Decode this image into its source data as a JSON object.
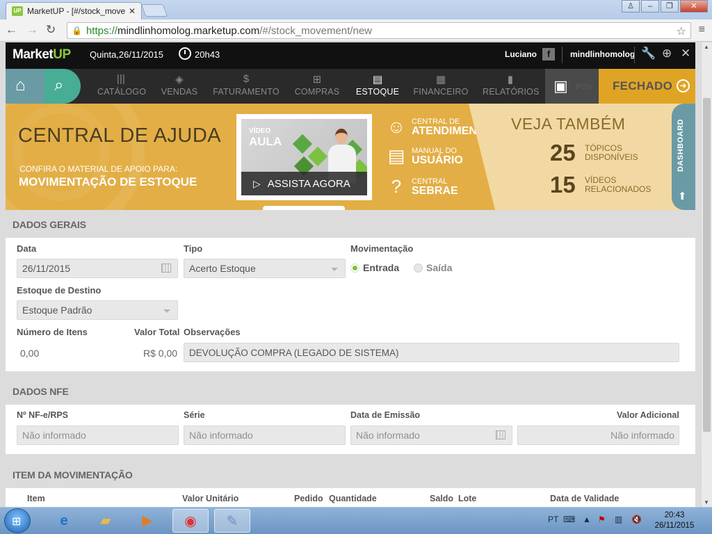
{
  "browser": {
    "tab_title": "MarketUP - [#/stock_move",
    "tab_favicon": "UP",
    "url_scheme": "https://",
    "url_host": "mindlinhomolog.marketup.com",
    "url_path": "/#/stock_movement/new"
  },
  "appbar": {
    "logo_market": "Market",
    "logo_up": "UP",
    "date": "Quinta,26/11/2015",
    "time": "20h43",
    "user": "Luciano",
    "account": "mindlinhomolog"
  },
  "nav": {
    "items": [
      {
        "label": "CATÁLOGO",
        "icon": "|||"
      },
      {
        "label": "VENDAS",
        "icon": "◈"
      },
      {
        "label": "FATURAMENTO",
        "icon": "$"
      },
      {
        "label": "COMPRAS",
        "icon": "⊞"
      },
      {
        "label": "ESTOQUE",
        "icon": "▤"
      },
      {
        "label": "FINANCEIRO",
        "icon": "▦"
      },
      {
        "label": "RELATÓRIOS",
        "icon": "▮"
      }
    ],
    "pdv": "PDV",
    "status": "FECHADO"
  },
  "banner": {
    "title": "CENTRAL DE AJUDA",
    "subtitle": "CONFIRA O MATERIAL DE APOIO PARA:",
    "topic": "MOVIMENTAÇÃO DE ESTOQUE",
    "video_tag1": "VÍDEO",
    "video_tag2": "AULA",
    "video_cta": "ASSISTA AGORA",
    "links": [
      {
        "line1": "CENTRAL DE",
        "line2": "ATENDIMENTO"
      },
      {
        "line1": "MANUAL DO",
        "line2": "USUÁRIO"
      },
      {
        "line1": "CENTRAL",
        "line2": "SEBRAE"
      }
    ],
    "see_also": "VEJA TAMBÉM",
    "topics_count": "25",
    "topics_label1": "TÓPICOS",
    "topics_label2": "DISPONÍVEIS",
    "videos_count": "15",
    "videos_label1": "VÍDEOS",
    "videos_label2": "RELACIONADOS",
    "dashboard": "DASHBOARD"
  },
  "dados_gerais": {
    "title": "DADOS GERAIS",
    "data_label": "Data",
    "data_value": "26/11/2015",
    "tipo_label": "Tipo",
    "tipo_value": "Acerto Estoque",
    "mov_label": "Movimentação",
    "mov_in": "Entrada",
    "mov_out": "Saída",
    "destino_label": "Estoque de Destino",
    "destino_value": "Estoque Padrão",
    "num_label": "Número de Itens",
    "num_value": "0,00",
    "total_label": "Valor Total",
    "total_value": "R$ 0,00",
    "obs_label": "Observações",
    "obs_value": "DEVOLUÇÃO COMPRA (LEGADO DE SISTEMA)"
  },
  "dados_nfe": {
    "title": "DADOS NFE",
    "nf_label": "Nº NF-e/RPS",
    "serie_label": "Série",
    "emissao_label": "Data de Emissão",
    "adicional_label": "Valor Adicional",
    "placeholder": "Não informado"
  },
  "itens": {
    "title": "ITEM DA MOVIMENTAÇÃO",
    "columns": [
      "Item",
      "Valor Unitário",
      "Pedido",
      "Quantidade",
      "Saldo",
      "Lote",
      "Data de Validade"
    ]
  },
  "taskbar": {
    "lang": "PT",
    "time": "20:43",
    "date": "26/11/2015"
  }
}
